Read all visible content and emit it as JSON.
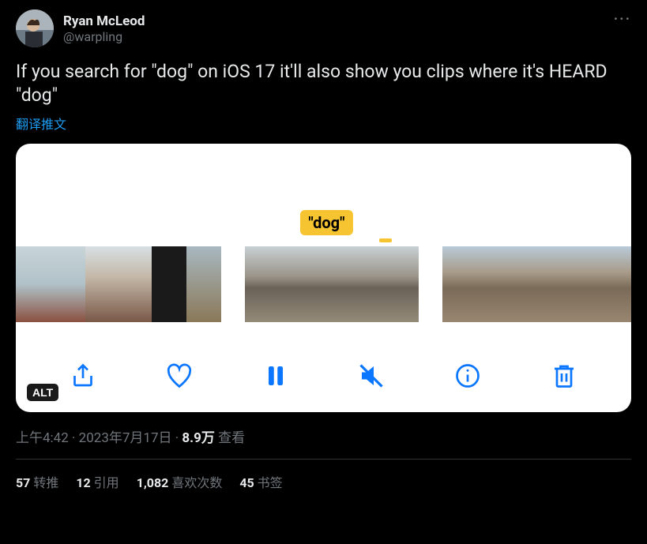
{
  "user": {
    "display_name": "Ryan McLeod",
    "handle": "@warpling"
  },
  "tweet": {
    "text": "If you search for \"dog\" on iOS 17 it'll also show you clips where it's HEARD \"dog\"",
    "translate_label": "翻译推文"
  },
  "media": {
    "search_term": "\"dog\"",
    "alt_label": "ALT"
  },
  "meta": {
    "time": "上午4:42",
    "dot1": " · ",
    "date": "2023年7月17日",
    "dot2": " · ",
    "views_count": "8.9万",
    "views_label": " 查看"
  },
  "stats": {
    "retweets_count": "57",
    "retweets_label": " 转推",
    "quotes_count": "12",
    "quotes_label": " 引用",
    "likes_count": "1,082",
    "likes_label": " 喜欢次数",
    "bookmarks_count": "45",
    "bookmarks_label": " 书签"
  }
}
